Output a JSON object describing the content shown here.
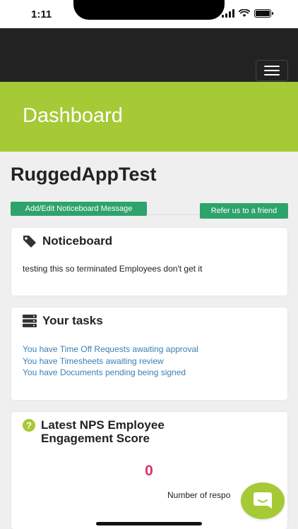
{
  "status_bar": {
    "time": "1:11"
  },
  "header": {
    "title": "Dashboard"
  },
  "company": {
    "name": "RuggedAppTest"
  },
  "actions": {
    "notice_button": "Add/Edit Noticeboard Message",
    "refer_button": "Refer us to a friend"
  },
  "noticeboard": {
    "title": "Noticeboard",
    "message": "testing this so terminated Employees don't get it"
  },
  "tasks": {
    "title": "Your tasks",
    "items": [
      "You have Time Off Requests awaiting approval",
      "You have Timesheets awaiting review",
      "You have Documents pending being signed"
    ]
  },
  "nps": {
    "title_line1": "Latest NPS Employee",
    "title_line2": "Engagement Score",
    "score": "0",
    "responses_label": "Number of respo"
  },
  "colors": {
    "brand_green": "#a6c936",
    "button_green": "#2ea36b",
    "link_blue": "#3a7fb5",
    "score_pink": "#d6336c",
    "navbar": "#222222"
  },
  "icons": {
    "menu": "hamburger-icon",
    "noticeboard": "tag-icon",
    "tasks": "server-icon",
    "nps": "question-circle-icon",
    "chat": "chat-bubble-icon"
  }
}
